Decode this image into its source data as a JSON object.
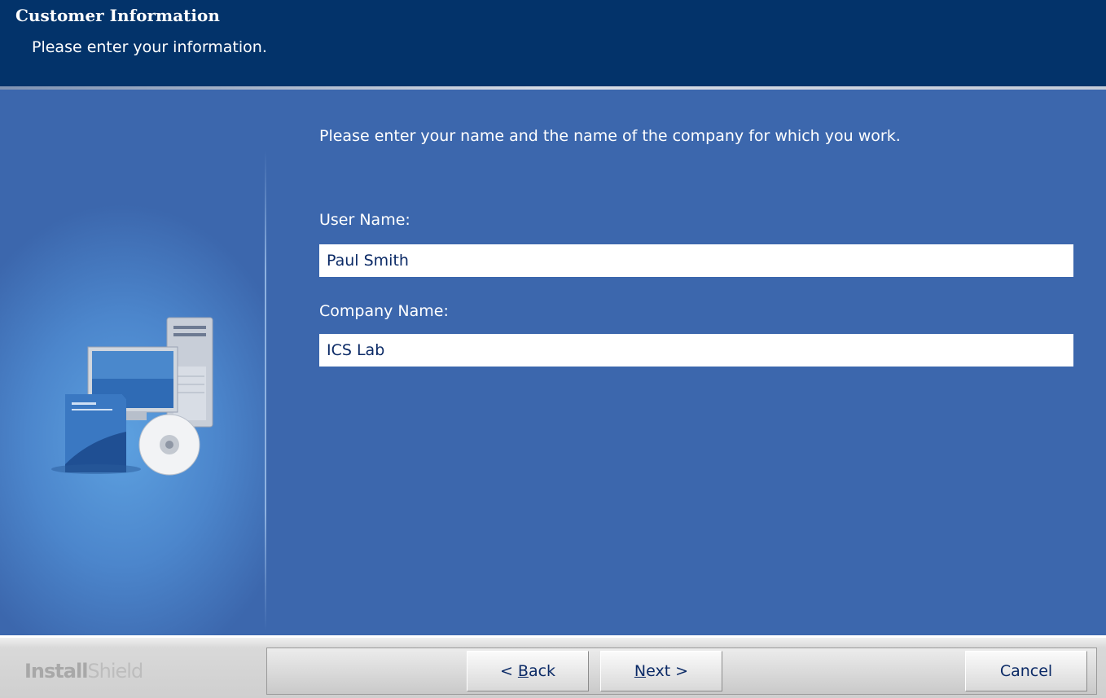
{
  "header": {
    "title": "Customer Information",
    "subtitle": "Please enter your information."
  },
  "main": {
    "instruction": "Please enter your name and the name of the company for which you work.",
    "user_name_label": "User Name:",
    "user_name_value": "Paul Smith",
    "company_name_label": "Company Name:",
    "company_name_value": "ICS Lab"
  },
  "footer": {
    "brand_part1": "Install",
    "brand_part2": "Shield",
    "back_prefix": "< ",
    "back_accel": "B",
    "back_rest": "ack",
    "next_accel": "N",
    "next_rest": "ext >",
    "cancel_label": "Cancel"
  },
  "icons": [
    "computer-setup-icon"
  ],
  "colors": {
    "header_bg": "#03336a",
    "body_bg": "#3c67ad",
    "text_field_text": "#0b2a66"
  }
}
